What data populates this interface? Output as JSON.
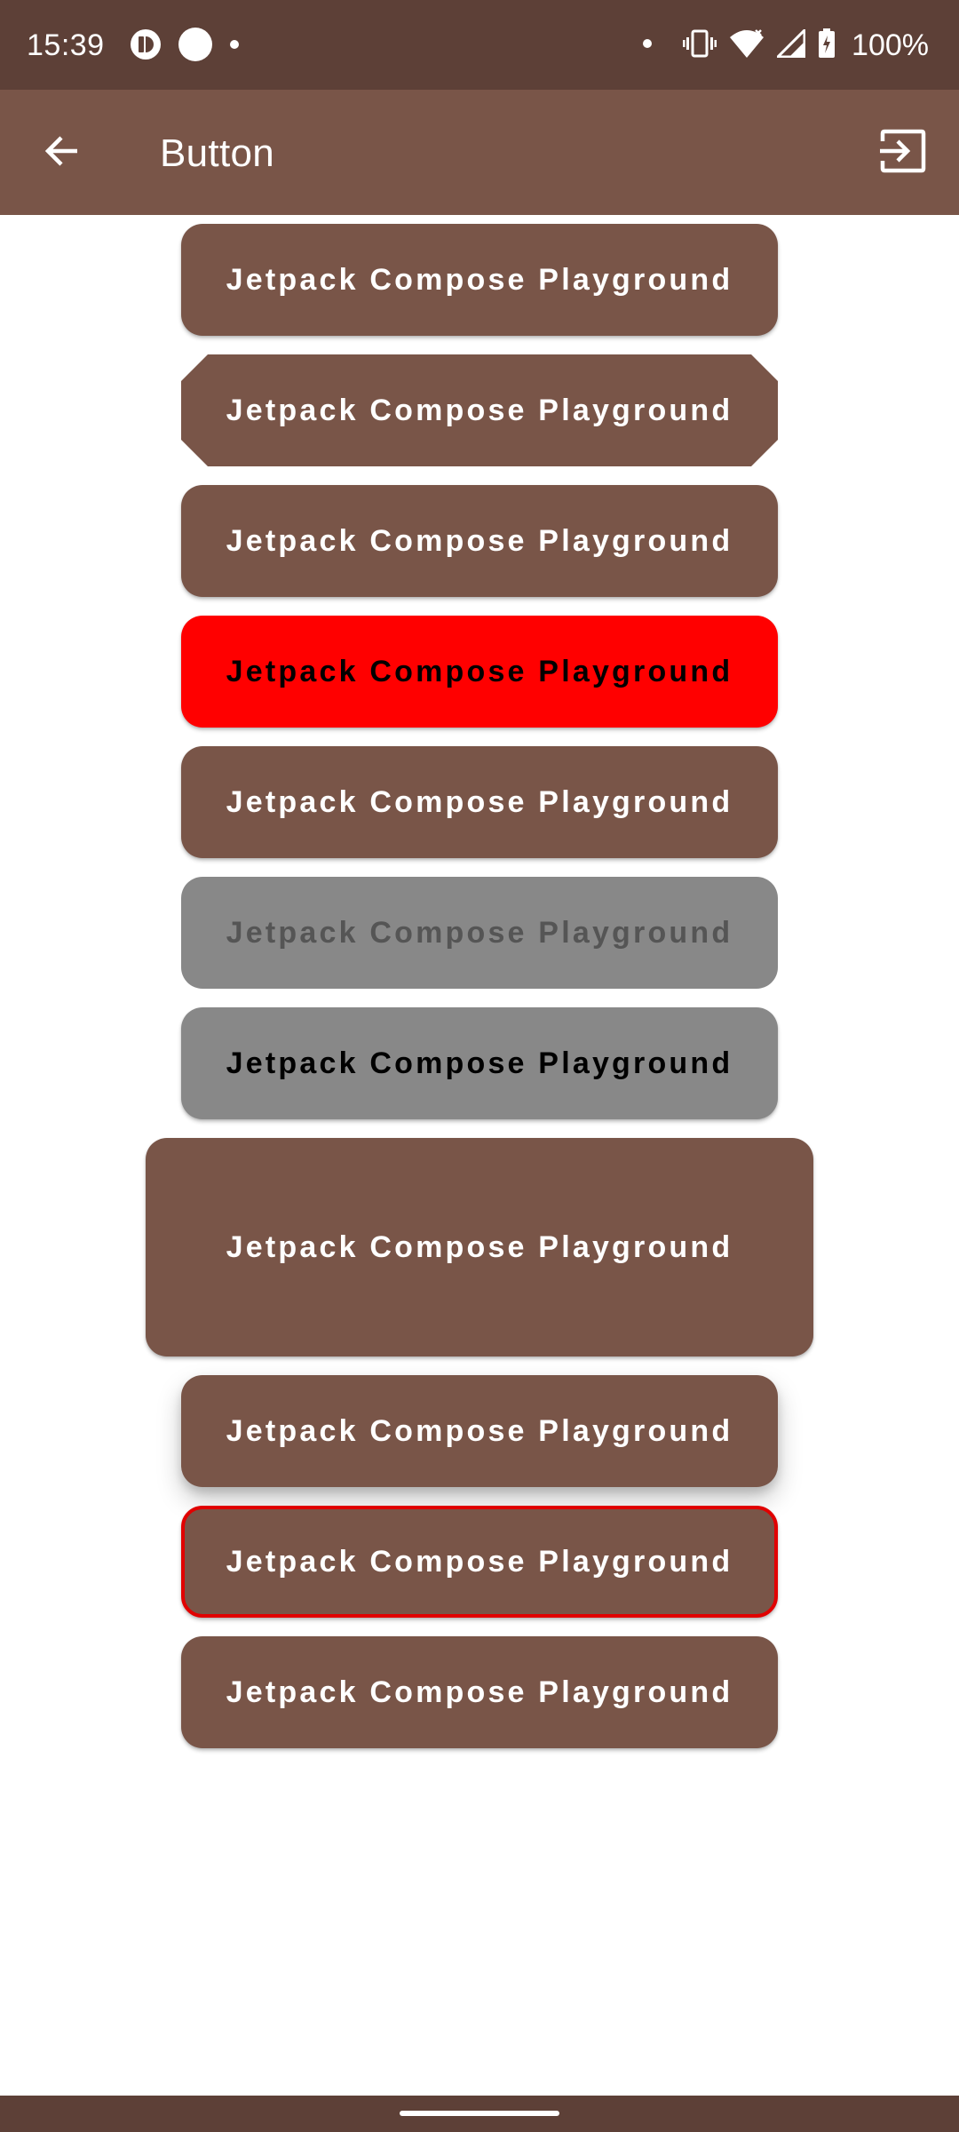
{
  "status_bar": {
    "time": "15:39",
    "battery": "100%",
    "icons": [
      "app-notification-icon",
      "circle-notification-icon",
      "dot-icon",
      "dot-icon",
      "vibrate-icon",
      "wifi-icon",
      "signal-icon",
      "battery-charging-icon"
    ]
  },
  "app_bar": {
    "title": "Button",
    "back_icon": "arrow-back-icon",
    "exit_icon": "exit-to-app-icon"
  },
  "buttons": [
    {
      "label": "Jetpack Compose Playground",
      "variant": "default"
    },
    {
      "label": "Jetpack Compose Playground",
      "variant": "cut-corner"
    },
    {
      "label": "Jetpack Compose Playground",
      "variant": "default"
    },
    {
      "label": "Jetpack Compose Playground",
      "variant": "red-background"
    },
    {
      "label": "Jetpack Compose Playground",
      "variant": "default"
    },
    {
      "label": "Jetpack Compose Playground",
      "variant": "disabled"
    },
    {
      "label": "Jetpack Compose Playground",
      "variant": "gray-background"
    },
    {
      "label": "Jetpack Compose Playground",
      "variant": "large-padding"
    },
    {
      "label": "Jetpack Compose Playground",
      "variant": "high-elevation"
    },
    {
      "label": "Jetpack Compose Playground",
      "variant": "red-border"
    },
    {
      "label": "Jetpack Compose Playground",
      "variant": "default"
    }
  ],
  "colors": {
    "status_bar": "#5d4037",
    "primary": "#795548",
    "red": "#ff0000",
    "gray": "#888888",
    "border_red": "#e10000"
  }
}
